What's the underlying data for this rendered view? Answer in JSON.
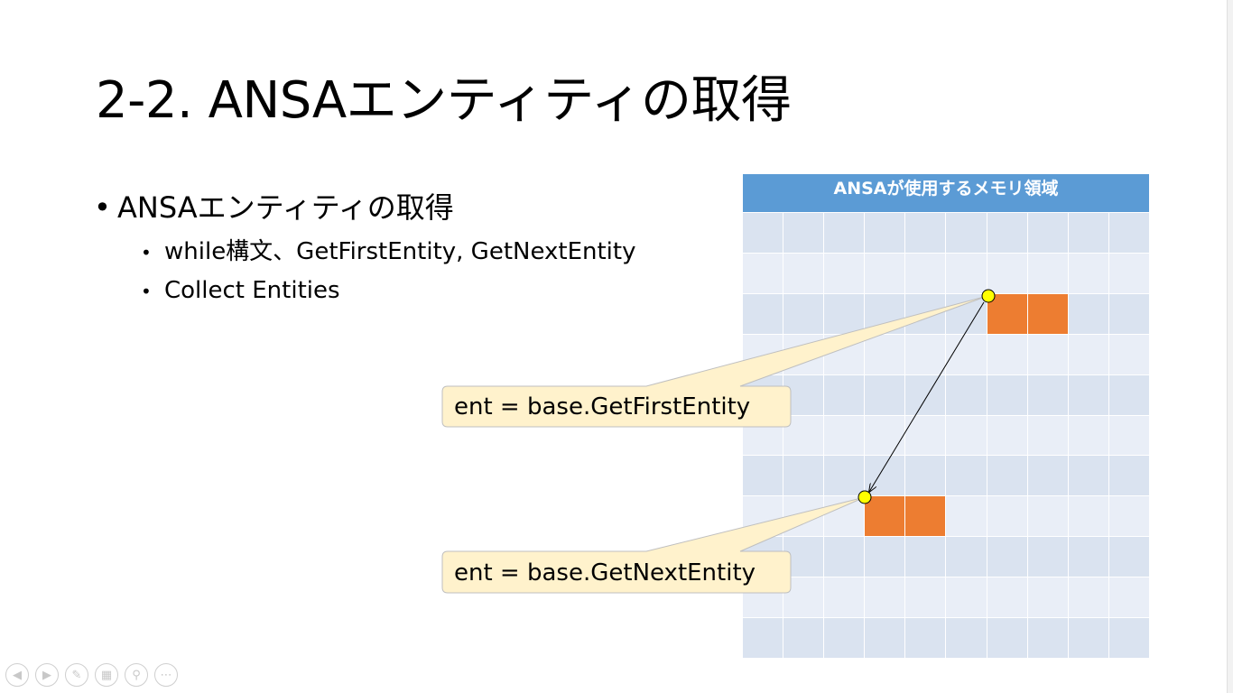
{
  "slide": {
    "title": "2-2. ANSAエンティティの取得",
    "bullet_main": "ANSAエンティティの取得",
    "sub_bullets": [
      "while構文、GetFirstEntity, GetNextEntity",
      "Collect Entities"
    ]
  },
  "memory": {
    "header": "ANSAが使用するメモリ領域",
    "colors": {
      "header": "#5b9bd5",
      "cell_dark": "#dae3f0",
      "cell_light": "#e9eef7",
      "entity": "#ed7d31",
      "pointer": "#ffff00",
      "callout_fill": "#fff2cc"
    }
  },
  "callouts": {
    "first": "ent = base.GetFirstEntity",
    "next": "ent = base.GetNextEntity"
  },
  "nav_controls": [
    "previous-icon",
    "next-icon",
    "pen-icon",
    "slides-icon",
    "zoom-icon",
    "more-icon"
  ]
}
